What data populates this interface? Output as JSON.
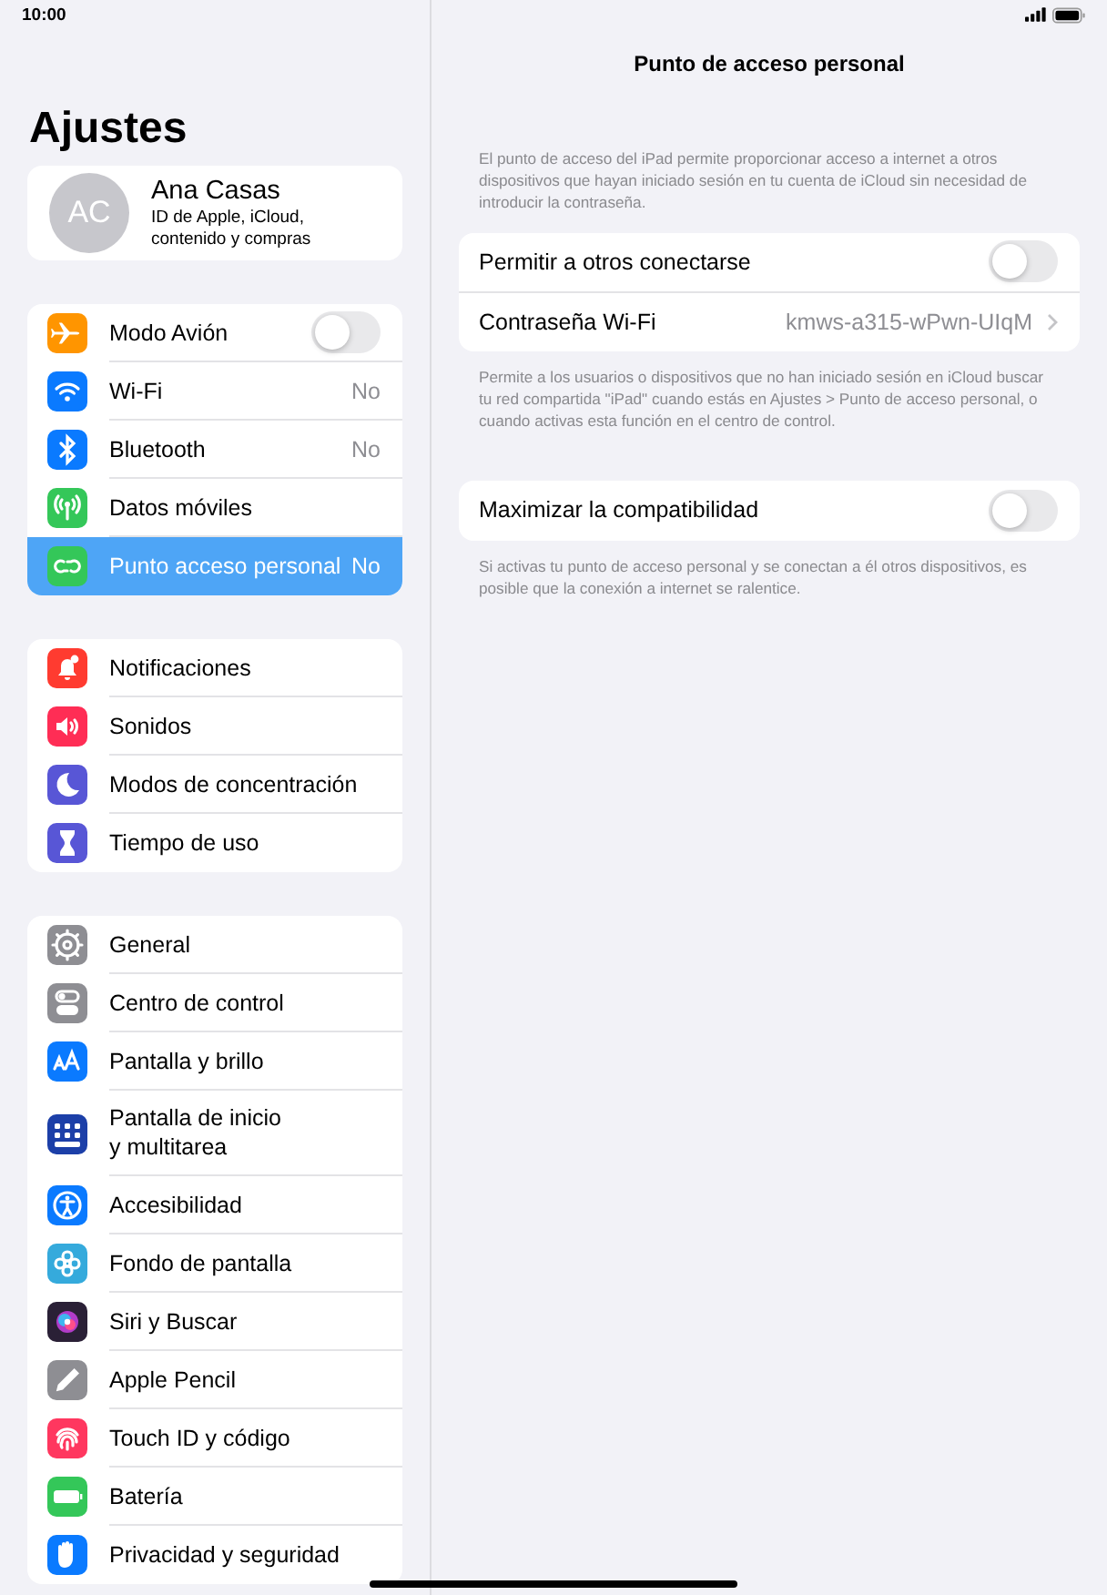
{
  "status_bar": {
    "time": "10:00"
  },
  "sidebar": {
    "title": "Ajustes",
    "profile": {
      "initials": "AC",
      "name": "Ana Casas",
      "subtitle": "ID de Apple, iCloud,\ncontenido y compras"
    },
    "groups": [
      {
        "items": [
          {
            "label": "Modo Avión",
            "kind": "toggle",
            "on": false,
            "selected": false,
            "color": "#ff9500"
          },
          {
            "label": "Wi-Fi",
            "kind": "value",
            "value": "No",
            "selected": false,
            "color": "#0a7aff"
          },
          {
            "label": "Bluetooth",
            "kind": "value",
            "value": "No",
            "selected": false,
            "color": "#0a7aff"
          },
          {
            "label": "Datos móviles",
            "kind": "plain",
            "selected": false,
            "color": "#34c759"
          },
          {
            "label": "Punto acceso personal",
            "kind": "value",
            "value": "No",
            "selected": true,
            "color": "#34c759"
          }
        ]
      },
      {
        "items": [
          {
            "label": "Notificaciones",
            "kind": "plain",
            "selected": false,
            "color": "#ff3b30"
          },
          {
            "label": "Sonidos",
            "kind": "plain",
            "selected": false,
            "color": "#ff2d55"
          },
          {
            "label": "Modos de concentración",
            "kind": "plain",
            "selected": false,
            "color": "#5856d6"
          },
          {
            "label": "Tiempo de uso",
            "kind": "plain",
            "selected": false,
            "color": "#5856d6"
          }
        ]
      },
      {
        "items": [
          {
            "label": "General",
            "kind": "plain",
            "selected": false,
            "color": "#8e8e93"
          },
          {
            "label": "Centro de control",
            "kind": "plain",
            "selected": false,
            "color": "#8e8e93"
          },
          {
            "label": "Pantalla y brillo",
            "kind": "plain",
            "selected": false,
            "color": "#0a7aff"
          },
          {
            "label": "Pantalla de inicio\ny multitarea",
            "kind": "plain",
            "selected": false,
            "color": "#1c3fa8"
          },
          {
            "label": "Accesibilidad",
            "kind": "plain",
            "selected": false,
            "color": "#0a7aff"
          },
          {
            "label": "Fondo de pantalla",
            "kind": "plain",
            "selected": false,
            "color": "#35aadc"
          },
          {
            "label": "Siri y Buscar",
            "kind": "plain",
            "selected": false,
            "color": "#2a2036"
          },
          {
            "label": "Apple Pencil",
            "kind": "plain",
            "selected": false,
            "color": "#8e8e93"
          },
          {
            "label": "Touch ID y código",
            "kind": "plain",
            "selected": false,
            "color": "#ff375f"
          },
          {
            "label": "Batería",
            "kind": "plain",
            "selected": false,
            "color": "#34c759"
          },
          {
            "label": "Privacidad y seguridad",
            "kind": "plain",
            "selected": false,
            "color": "#0a7aff"
          }
        ]
      }
    ]
  },
  "detail": {
    "title": "Punto de acceso personal",
    "sections": [
      {
        "header": "El punto de acceso del iPad permite proporcionar acceso a internet a otros dispositivos que hayan iniciado sesión en tu cuenta de iCloud sin necesidad de introducir la contraseña.",
        "rows": [
          {
            "label": "Permitir a otros conectarse",
            "kind": "toggle",
            "on": false
          },
          {
            "label": "Contraseña Wi-Fi",
            "kind": "link",
            "value": "kmws-a315-wPwn-UIqM"
          }
        ],
        "footer": "Permite a los usuarios o dispositivos que no han iniciado sesión en iCloud buscar tu red compartida \"iPad\" cuando estás en Ajustes > Punto de acceso personal, o cuando activas esta función en el centro de control."
      },
      {
        "rows": [
          {
            "label": "Maximizar la compatibilidad",
            "kind": "toggle",
            "on": false
          }
        ],
        "footer": "Si activas tu punto de acceso personal y se conectan a él otros dispositivos, es posible que la conexión a internet se ralentice."
      }
    ]
  }
}
